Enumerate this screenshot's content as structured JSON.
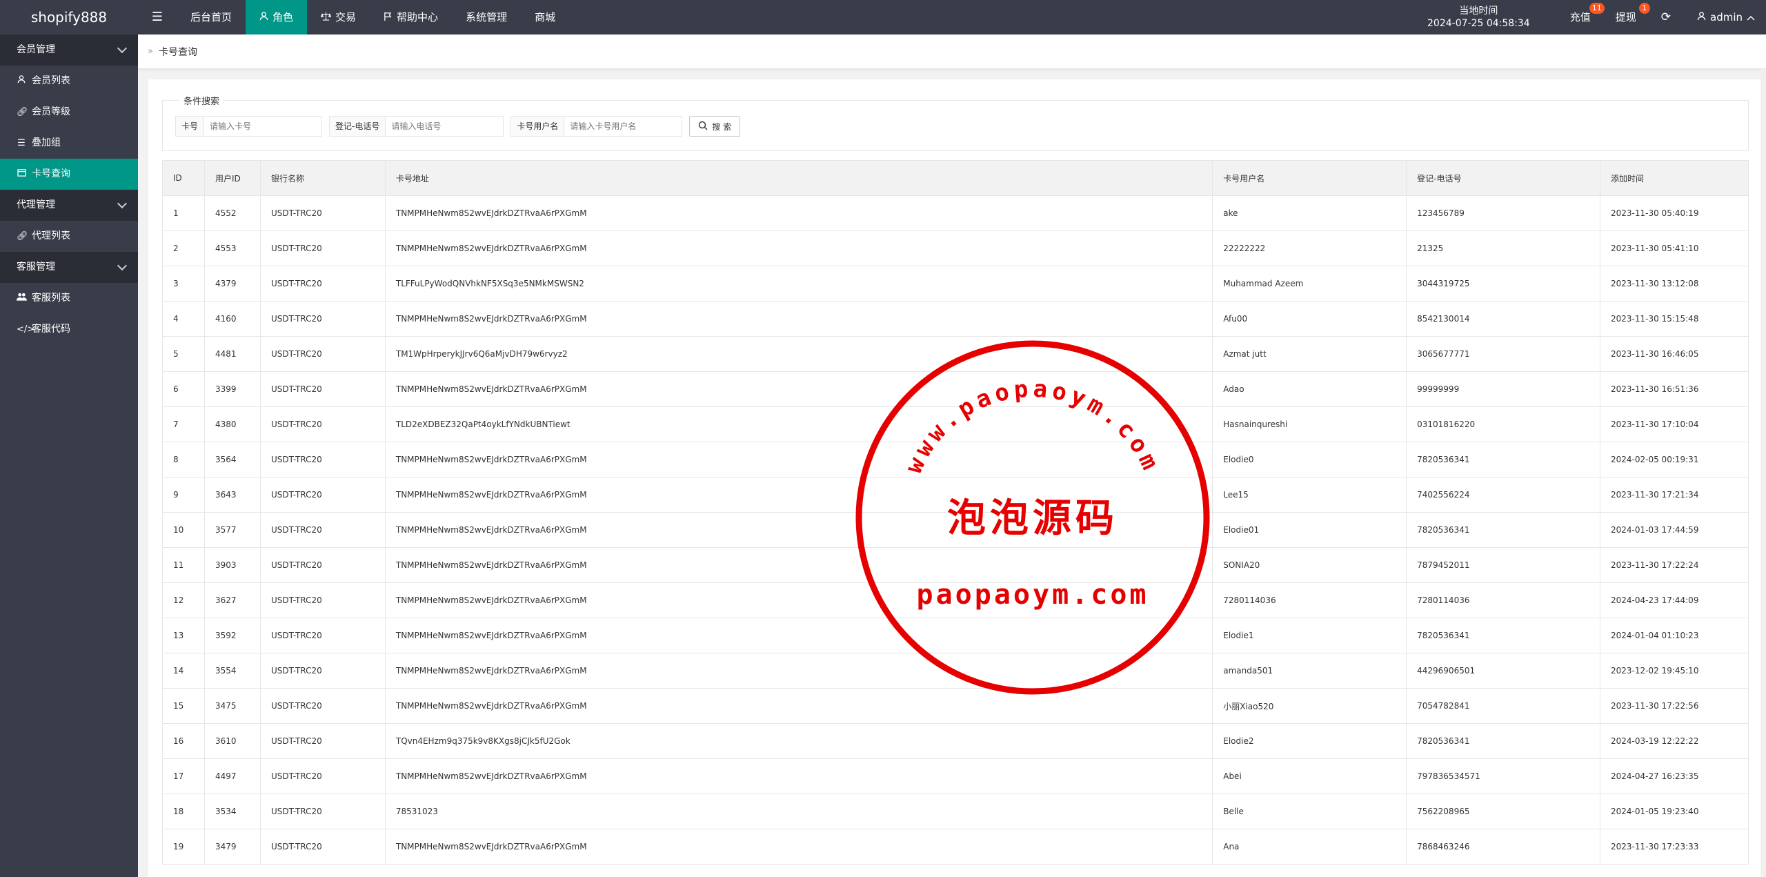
{
  "app": {
    "title": "shopify888"
  },
  "nav": {
    "toggle_icon": "menu-icon",
    "items": [
      {
        "label": "后台首页",
        "active": false
      },
      {
        "label": "角色",
        "active": true,
        "icon": "user-icon"
      },
      {
        "label": "交易",
        "active": false,
        "icon": "scale-icon"
      },
      {
        "label": "帮助中心",
        "active": false,
        "icon": "flag-icon"
      },
      {
        "label": "系统管理",
        "active": false
      },
      {
        "label": "商城",
        "active": false
      }
    ]
  },
  "header_right": {
    "clock_label": "当地时间",
    "clock_value": "2024-07-25 04:58:34",
    "recharge_label": "充值",
    "recharge_badge": "11",
    "withdraw_label": "提现",
    "withdraw_badge": "1",
    "user_name": "admin"
  },
  "sidebar": {
    "groups": [
      {
        "label": "会员管理",
        "items": [
          {
            "label": "会员列表",
            "icon": "user-icon"
          },
          {
            "label": "会员等级",
            "icon": "link-icon"
          },
          {
            "label": "叠加组",
            "icon": "list-icon"
          },
          {
            "label": "卡号查询",
            "icon": "card-icon",
            "active": true
          }
        ]
      },
      {
        "label": "代理管理",
        "items": [
          {
            "label": "代理列表",
            "icon": "link-icon"
          }
        ]
      },
      {
        "label": "客服管理",
        "items": [
          {
            "label": "客服列表",
            "icon": "users-icon"
          },
          {
            "label": "客服代码",
            "icon": "code-icon"
          }
        ]
      }
    ]
  },
  "breadcrumb": {
    "current": "卡号查询"
  },
  "search": {
    "legend": "条件搜索",
    "fields": [
      {
        "label": "卡号",
        "placeholder": "请输入卡号"
      },
      {
        "label": "登记-电话号",
        "placeholder": "请输入电话号"
      },
      {
        "label": "卡号用户名",
        "placeholder": "请输入卡号用户名"
      }
    ],
    "button_label": "搜 索"
  },
  "table": {
    "columns": [
      "ID",
      "用户ID",
      "银行名称",
      "卡号地址",
      "卡号用户名",
      "登记-电话号",
      "添加时间"
    ],
    "rows": [
      [
        "1",
        "4552",
        "USDT-TRC20",
        "TNMPMHeNwm8S2wvEJdrkDZTRvaA6rPXGmM",
        "ake",
        "123456789",
        "2023-11-30 05:40:19"
      ],
      [
        "2",
        "4553",
        "USDT-TRC20",
        "TNMPMHeNwm8S2wvEJdrkDZTRvaA6rPXGmM",
        "22222222",
        "21325",
        "2023-11-30 05:41:10"
      ],
      [
        "3",
        "4379",
        "USDT-TRC20",
        "TLFFuLPyWodQNVhkNF5XSq3e5NMkMSWSN2",
        "Muhammad Azeem",
        "3044319725",
        "2023-11-30 13:12:08"
      ],
      [
        "4",
        "4160",
        "USDT-TRC20",
        "TNMPMHeNwm8S2wvEJdrkDZTRvaA6rPXGmM",
        "Afu00",
        "8542130014",
        "2023-11-30 15:15:48"
      ],
      [
        "5",
        "4481",
        "USDT-TRC20",
        "TM1WpHrperykJJrv6Q6aMjvDH79w6rvyz2",
        "Azmat jutt",
        "3065677771",
        "2023-11-30 16:46:05"
      ],
      [
        "6",
        "3399",
        "USDT-TRC20",
        "TNMPMHeNwm8S2wvEJdrkDZTRvaA6rPXGmM",
        "Adao",
        "99999999",
        "2023-11-30 16:51:36"
      ],
      [
        "7",
        "4380",
        "USDT-TRC20",
        "TLD2eXDBEZ32QaPt4oykLfYNdkUBNTiewt",
        "Hasnainqureshi",
        "03101816220",
        "2023-11-30 17:10:04"
      ],
      [
        "8",
        "3564",
        "USDT-TRC20",
        "TNMPMHeNwm8S2wvEJdrkDZTRvaA6rPXGmM",
        "Elodie0",
        "7820536341",
        "2024-02-05 00:19:31"
      ],
      [
        "9",
        "3643",
        "USDT-TRC20",
        "TNMPMHeNwm8S2wvEJdrkDZTRvaA6rPXGmM",
        "Lee15",
        "7402556224",
        "2023-11-30 17:21:34"
      ],
      [
        "10",
        "3577",
        "USDT-TRC20",
        "TNMPMHeNwm8S2wvEJdrkDZTRvaA6rPXGmM",
        "Elodie01",
        "7820536341",
        "2024-01-03 17:44:59"
      ],
      [
        "11",
        "3903",
        "USDT-TRC20",
        "TNMPMHeNwm8S2wvEJdrkDZTRvaA6rPXGmM",
        "SONIA20",
        "7879452011",
        "2023-11-30 17:22:24"
      ],
      [
        "12",
        "3627",
        "USDT-TRC20",
        "TNMPMHeNwm8S2wvEJdrkDZTRvaA6rPXGmM",
        "7280114036",
        "7280114036",
        "2024-04-23 17:44:09"
      ],
      [
        "13",
        "3592",
        "USDT-TRC20",
        "TNMPMHeNwm8S2wvEJdrkDZTRvaA6rPXGmM",
        "Elodie1",
        "7820536341",
        "2024-01-04 01:10:23"
      ],
      [
        "14",
        "3554",
        "USDT-TRC20",
        "TNMPMHeNwm8S2wvEJdrkDZTRvaA6rPXGmM",
        "amanda501",
        "44296906501",
        "2023-12-02 19:45:10"
      ],
      [
        "15",
        "3475",
        "USDT-TRC20",
        "TNMPMHeNwm8S2wvEJdrkDZTRvaA6rPXGmM",
        "小丽Xiao520",
        "7054782841",
        "2023-11-30 17:22:56"
      ],
      [
        "16",
        "3610",
        "USDT-TRC20",
        "TQvn4EHzm9q375k9v8KXgs8jCJk5fU2Gok",
        "Elodie2",
        "7820536341",
        "2024-03-19 12:22:22"
      ],
      [
        "17",
        "4497",
        "USDT-TRC20",
        "TNMPMHeNwm8S2wvEJdrkDZTRvaA6rPXGmM",
        "Abei",
        "797836534571",
        "2024-04-27 16:23:35"
      ],
      [
        "18",
        "3534",
        "USDT-TRC20",
        "78531023",
        "Belle",
        "7562208965",
        "2024-01-05 19:23:40"
      ],
      [
        "19",
        "3479",
        "USDT-TRC20",
        "TNMPMHeNwm8S2wvEJdrkDZTRvaA6rPXGmM",
        "Ana",
        "7868463246",
        "2023-11-30 17:23:33"
      ]
    ]
  },
  "watermark": {
    "arc_text": "www.paopaoym.com",
    "center_text": "泡泡源码",
    "bottom_text": "paopaoym.com",
    "color": "#e60000"
  },
  "colors": {
    "topbar": "#393d49",
    "accent": "#009688",
    "badge": "#ff5722"
  }
}
